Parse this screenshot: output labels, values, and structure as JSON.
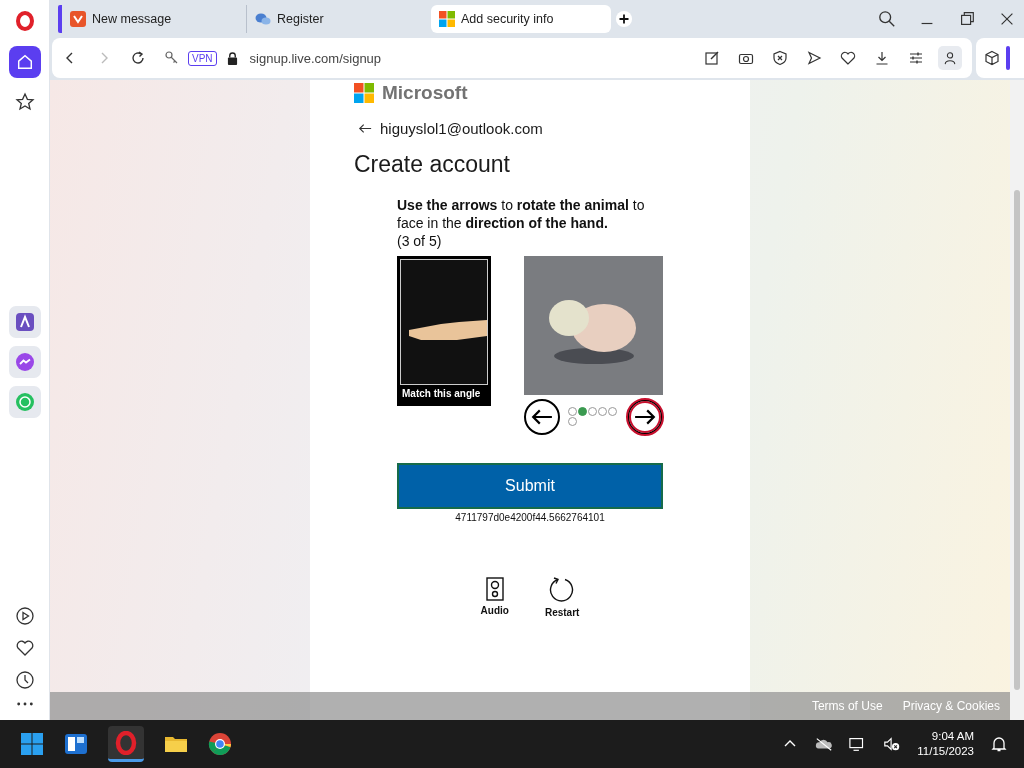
{
  "tabs": [
    {
      "title": "New message",
      "selected": false
    },
    {
      "title": "Register",
      "selected": false
    },
    {
      "title": "Add security info",
      "selected": true
    }
  ],
  "address_bar": {
    "vpn_badge": "VPN",
    "url": "signup.live.com/signup"
  },
  "page": {
    "brand": "Microsoft",
    "email": "higuyslol1@outlook.com",
    "heading": "Create account",
    "instruction": "**Use the arrows** to **rotate the animal** to face in the **direction of the hand.**",
    "progress": "(3 of 5)",
    "reference_caption": "Match this angle",
    "prev_button": {
      "focused": false
    },
    "next_button": {
      "focused": true
    },
    "dots": [
      {
        "selected": false
      },
      {
        "selected": true
      },
      {
        "selected": false
      },
      {
        "selected": false
      },
      {
        "selected": false
      },
      {
        "selected": false
      }
    ],
    "submit": "Submit",
    "token": "4711797d0e4200f44.5662764101",
    "tools": [
      {
        "kind": "audio",
        "label": "Audio"
      },
      {
        "kind": "restart",
        "label": "Restart"
      }
    ]
  },
  "footer_links": [
    "Terms of Use",
    "Privacy & Cookies"
  ],
  "taskbar": {
    "time": "9:04 AM",
    "date": "11/15/2023"
  }
}
